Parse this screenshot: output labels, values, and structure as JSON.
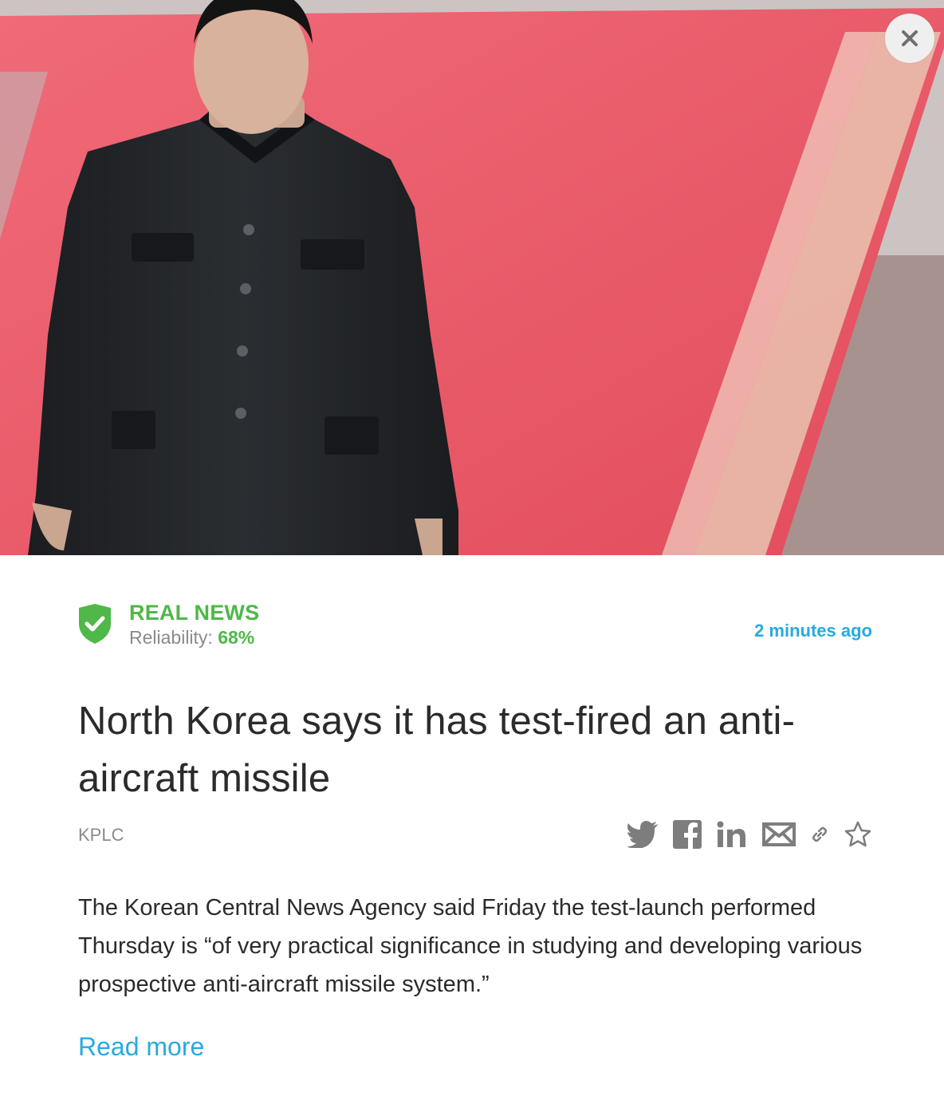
{
  "hero": {
    "close_icon": "close-icon"
  },
  "article": {
    "status_label": "REAL NEWS",
    "reliability_label": "Reliability:",
    "reliability_value": "68%",
    "timestamp": "2 minutes ago",
    "title": "North Korea says it has test-fired an anti-aircraft missile",
    "source": "KPLC",
    "summary": "The Korean Central News Agency said Friday the test-launch performed Thursday is “of very practical significance in studying and developing various prospective anti-aircraft missile system.”",
    "read_more": "Read more"
  },
  "share": {
    "icons": [
      "twitter-icon",
      "facebook-icon",
      "linkedin-icon",
      "email-icon",
      "link-icon",
      "star-icon"
    ]
  },
  "colors": {
    "accent_green": "#4fb848",
    "accent_blue": "#27aae1",
    "text": "#2b2b2b",
    "muted": "#8a8a8a",
    "icon_gray": "#7d7d7d"
  }
}
